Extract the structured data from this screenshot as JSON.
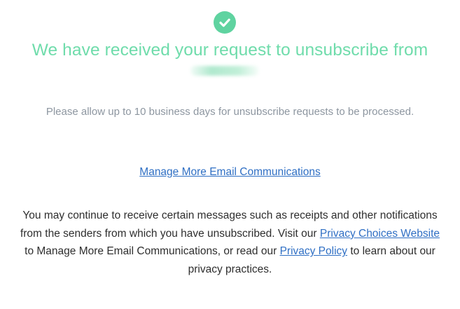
{
  "status_icon": "checkmark-circle-icon",
  "colors": {
    "accent_green": "#6fdcab",
    "link_blue": "#2f6fc4",
    "muted_text": "#8d96a0",
    "body_text": "#2e2e2e"
  },
  "headline": "We have received your request to unsubscribe from",
  "processing_note": "Please allow up to 10 business days for unsubscribe requests to be processed.",
  "manage_link": "Manage More Email Communications",
  "disclaimer": {
    "line1": "You may continue to receive certain messages such as receipts and other notifications",
    "line2_text": "from the senders from which you have unsubscribed. Visit our ",
    "privacy_choices_link": "Privacy Choices Website",
    "line3_text_before": "to Manage More Email Communications, or read our ",
    "privacy_policy_link": "Privacy Policy",
    "line3_text_after": " to learn about our",
    "line4": "privacy practices."
  }
}
